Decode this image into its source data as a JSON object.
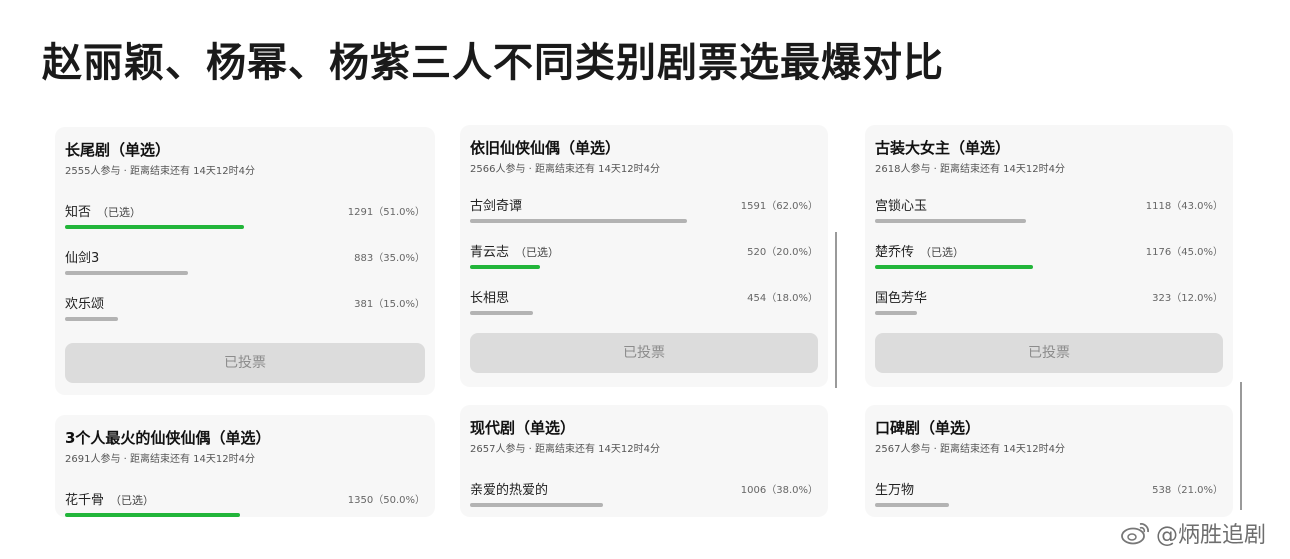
{
  "page": {
    "title": "赵丽颖、杨幂、杨紫三人不同类别剧票选最爆对比"
  },
  "cards": [
    {
      "title": "长尾剧（单选）",
      "meta": "2555人参与 · 距离结束还有 14天12时4分",
      "options": [
        {
          "label": "知否",
          "voted": "（已选）",
          "count": "1291（51.0%）",
          "percent": 51,
          "selected": true
        },
        {
          "label": "仙剑3",
          "voted": "",
          "count": "883（35.0%）",
          "percent": 35,
          "selected": false
        },
        {
          "label": "欢乐颂",
          "voted": "",
          "count": "381（15.0%）",
          "percent": 15,
          "selected": false
        }
      ],
      "button": "已投票"
    },
    {
      "title": "依旧仙侠仙偶（单选）",
      "meta": "2566人参与 · 距离结束还有 14天12时4分",
      "options": [
        {
          "label": "古剑奇谭",
          "voted": "",
          "count": "1591（62.0%）",
          "percent": 62,
          "selected": false
        },
        {
          "label": "青云志",
          "voted": "（已选）",
          "count": "520（20.0%）",
          "percent": 20,
          "selected": true
        },
        {
          "label": "长相思",
          "voted": "",
          "count": "454（18.0%）",
          "percent": 18,
          "selected": false
        }
      ],
      "button": "已投票"
    },
    {
      "title": "古装大女主（单选）",
      "meta": "2618人参与 · 距离结束还有 14天12时4分",
      "options": [
        {
          "label": "宫锁心玉",
          "voted": "",
          "count": "1118（43.0%）",
          "percent": 43,
          "selected": false
        },
        {
          "label": "楚乔传",
          "voted": "（已选）",
          "count": "1176（45.0%）",
          "percent": 45,
          "selected": true
        },
        {
          "label": "国色芳华",
          "voted": "",
          "count": "323（12.0%）",
          "percent": 12,
          "selected": false
        }
      ],
      "button": "已投票"
    },
    {
      "title": "3个人最火的仙侠仙偶（单选）",
      "meta": "2691人参与 · 距离结束还有 14天12时4分",
      "options": [
        {
          "label": "花千骨",
          "voted": "（已选）",
          "count": "1350（50.0%）",
          "percent": 50,
          "selected": true
        }
      ]
    },
    {
      "title": "现代剧（单选）",
      "meta": "2657人参与 · 距离结束还有 14天12时4分",
      "options": [
        {
          "label": "亲爱的热爱的",
          "voted": "",
          "count": "1006（38.0%）",
          "percent": 38,
          "selected": false
        }
      ]
    },
    {
      "title": "口碑剧（单选）",
      "meta": "2567人参与 · 距离结束还有 14天12时4分",
      "options": [
        {
          "label": "生万物",
          "voted": "",
          "count": "538（21.0%）",
          "percent": 21,
          "selected": false
        }
      ]
    }
  ],
  "watermark": {
    "text": "@炳胜追剧",
    "icon": "weibo-icon"
  },
  "colors": {
    "selected_bar": "#22b53a",
    "bar": "#b3b3b3",
    "card_bg": "#f7f7f7",
    "button_bg": "#dcdcdc"
  }
}
